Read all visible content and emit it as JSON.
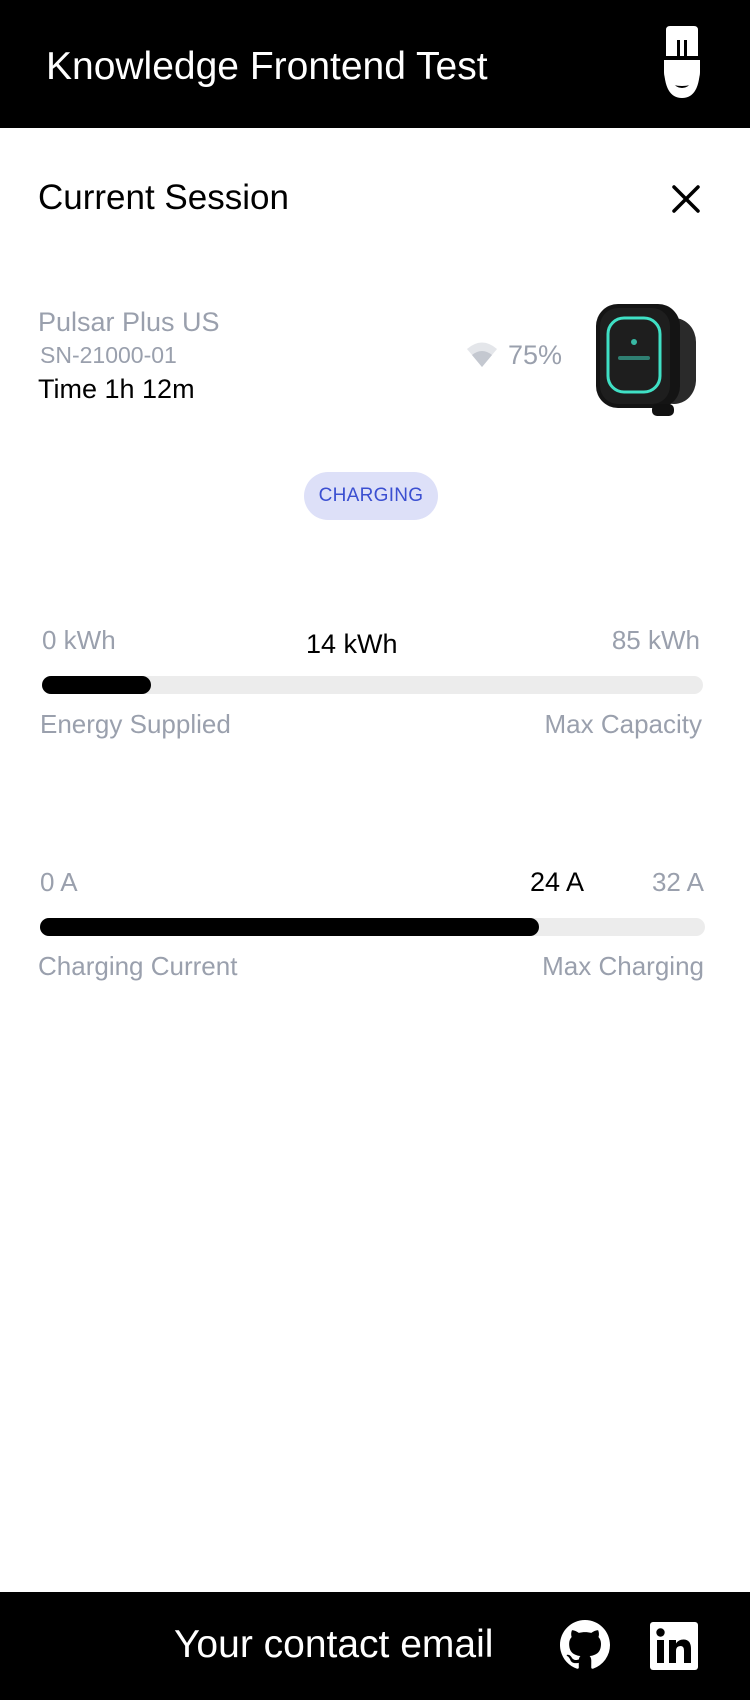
{
  "header": {
    "title": "Knowledge Frontend Test",
    "logo_icon": "wallbox-logo-icon"
  },
  "session": {
    "title": "Current Session",
    "close_icon": "close-icon"
  },
  "device": {
    "name": "Pulsar Plus US",
    "serial": "SN-21000-01",
    "time": "Time 1h 12m",
    "signal_icon": "wifi-icon",
    "signal_strength": "75%",
    "status": "CHARGING",
    "status_color": "#3b4fd1",
    "status_bg": "#dde0f8"
  },
  "energy": {
    "min_label": "0 kWh",
    "current_label": "14 kWh",
    "max_label": "85 kWh",
    "left_caption": "Energy Supplied",
    "right_caption": "Max Capacity",
    "current_value": 14,
    "max_value": 85
  },
  "current": {
    "min_label": "0 A",
    "current_label": "24 A",
    "max_label": "32 A",
    "left_caption": "Charging Current",
    "right_caption": "Max Charging",
    "current_value": 24,
    "max_value": 32
  },
  "footer": {
    "contact_label": "Your contact email",
    "github_icon": "github-icon",
    "linkedin_icon": "linkedin-icon"
  },
  "colors": {
    "muted_text": "#9aa0ad",
    "bar_fill": "#000000",
    "bar_track": "#ececec",
    "charger_accent": "#3fe0c5"
  }
}
